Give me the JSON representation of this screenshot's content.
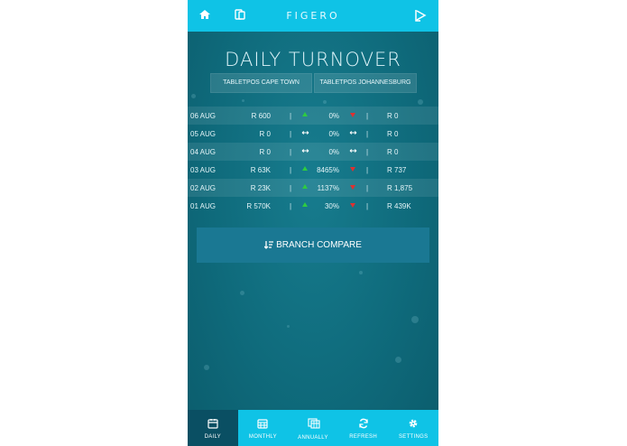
{
  "header": {
    "brand": "FIGERO"
  },
  "page": {
    "title": "DAILY TURNOVER"
  },
  "branches": [
    "TABLETPOS CAPE TOWN",
    "TABLETPOS JOHANNESBURG"
  ],
  "rows": [
    {
      "date": "06 AUG",
      "value": "R 600",
      "sep": "|",
      "trend": "up",
      "pct": "0%",
      "trend2": "down",
      "sep2": "|",
      "prev": "R 0"
    },
    {
      "date": "05 AUG",
      "value": "R 0",
      "sep": "|",
      "trend": "flat",
      "pct": "0%",
      "trend2": "flat",
      "sep2": "|",
      "prev": "R 0"
    },
    {
      "date": "04 AUG",
      "value": "R 0",
      "sep": "|",
      "trend": "flat",
      "pct": "0%",
      "trend2": "flat",
      "sep2": "|",
      "prev": "R 0"
    },
    {
      "date": "03 AUG",
      "value": "R 63K",
      "sep": "|",
      "trend": "up",
      "pct": "8465%",
      "trend2": "down",
      "sep2": "|",
      "prev": "R 737"
    },
    {
      "date": "02 AUG",
      "value": "R 23K",
      "sep": "|",
      "trend": "up",
      "pct": "1137%",
      "trend2": "down",
      "sep2": "|",
      "prev": "R 1,875"
    },
    {
      "date": "01 AUG",
      "value": "R 570K",
      "sep": "|",
      "trend": "up",
      "pct": "30%",
      "trend2": "down",
      "sep2": "|",
      "prev": "R 439K"
    }
  ],
  "compare_button": {
    "label": "BRANCH COMPARE"
  },
  "tabs": [
    {
      "label": "DAILY",
      "icon": "calendar-day-icon",
      "active": true
    },
    {
      "label": "MONTHLY",
      "icon": "calendar-month-icon",
      "active": false
    },
    {
      "label": "ANNUALLY",
      "icon": "calendar-year-icon",
      "active": false
    },
    {
      "label": "REFRESH",
      "icon": "refresh-icon",
      "active": false
    },
    {
      "label": "SETTINGS",
      "icon": "gear-icon",
      "active": false
    }
  ],
  "colors": {
    "topbar": "#0fc3e6",
    "background": "#0f6b7c",
    "up": "#2ecc40",
    "down": "#e03030",
    "active_tab": "#0a4f63"
  }
}
